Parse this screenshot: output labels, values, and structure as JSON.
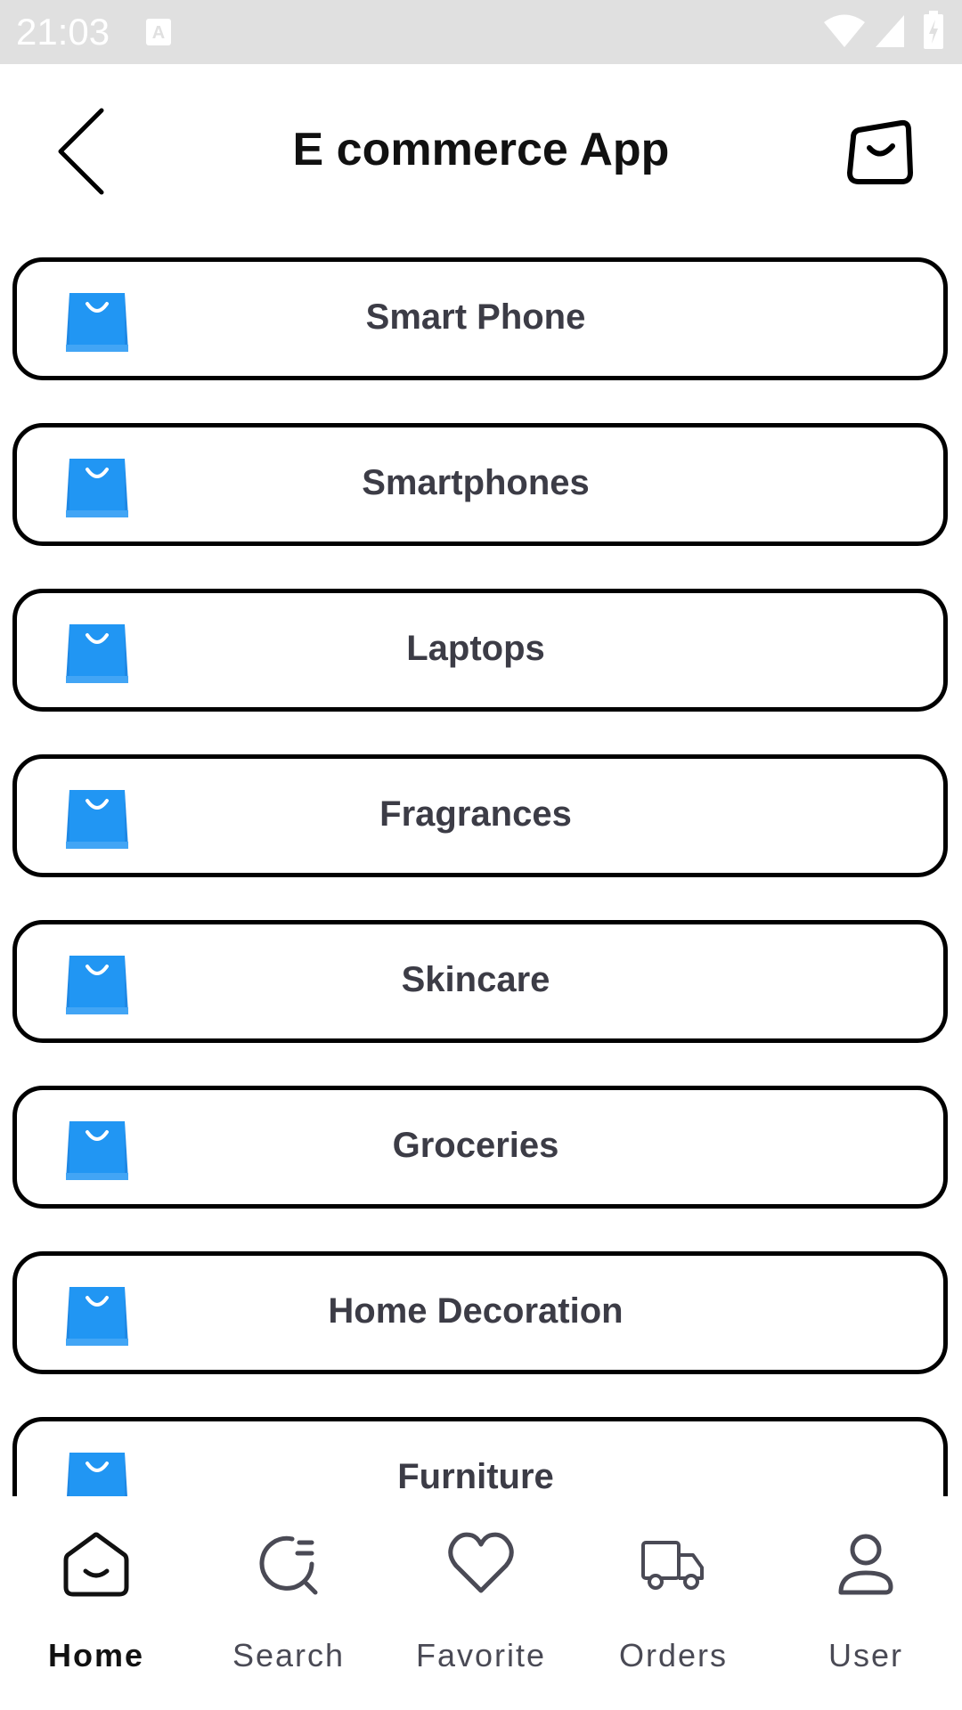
{
  "status_bar": {
    "time": "21:03",
    "icons": [
      "a-notification-icon",
      "wifi-icon",
      "signal-icon",
      "battery-icon"
    ]
  },
  "app_bar": {
    "title": "E commerce App",
    "back_icon": "chevron-left-icon",
    "cart_icon": "shopping-bag-icon"
  },
  "categories": [
    {
      "label": "Smart Phone",
      "icon": "blue-shopping-bag-icon"
    },
    {
      "label": "Smartphones",
      "icon": "blue-shopping-bag-icon"
    },
    {
      "label": "Laptops",
      "icon": "blue-shopping-bag-icon"
    },
    {
      "label": "Fragrances",
      "icon": "blue-shopping-bag-icon"
    },
    {
      "label": "Skincare",
      "icon": "blue-shopping-bag-icon"
    },
    {
      "label": "Groceries",
      "icon": "blue-shopping-bag-icon"
    },
    {
      "label": "Home Decoration",
      "icon": "blue-shopping-bag-icon"
    },
    {
      "label": "Furniture",
      "icon": "blue-shopping-bag-icon"
    }
  ],
  "bottom_nav": {
    "items": [
      {
        "label": "Home",
        "icon": "home-icon",
        "active": true
      },
      {
        "label": "Search",
        "icon": "search-icon",
        "active": false
      },
      {
        "label": "Favorite",
        "icon": "heart-icon",
        "active": false
      },
      {
        "label": "Orders",
        "icon": "truck-icon",
        "active": false
      },
      {
        "label": "User",
        "icon": "user-icon",
        "active": false
      }
    ]
  },
  "colors": {
    "status_bar_bg": "#e0e0e0",
    "border": "#000000",
    "label_text": "#3c3c46",
    "bag_blue": "#1e88e5"
  }
}
